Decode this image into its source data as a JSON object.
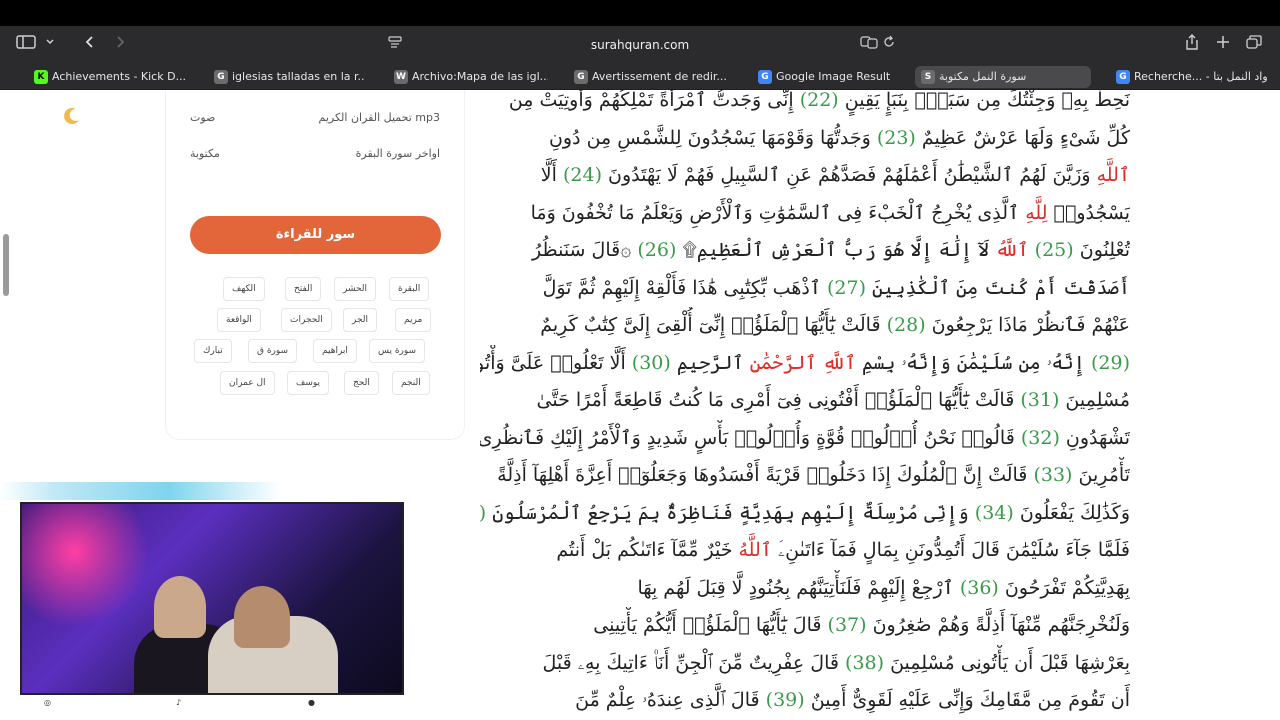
{
  "browser": {
    "url": "surahquran.com",
    "tabs": [
      {
        "label": "Achievements - Kick D...",
        "fav": "K",
        "color": "#53fc18"
      },
      {
        "label": "iglesias talladas en la r...",
        "fav": "G",
        "color": "#6b6b6b"
      },
      {
        "label": "Archivo:Mapa de las igl...",
        "fav": "W",
        "color": "#6b6b6b"
      },
      {
        "label": "Avertissement de redir...",
        "fav": "G",
        "color": "#6b6b6b"
      },
      {
        "label": "Google Image Result",
        "fav": "G",
        "color": "#4285f4"
      },
      {
        "label": "سورة النمل مكتوبة",
        "fav": "S",
        "color": "#6b6b6b"
      },
      {
        "label": "Recherche... - واد النمل بتا",
        "fav": "G",
        "color": "#4285f4"
      }
    ]
  },
  "sidebar": {
    "rows": [
      {
        "left": "صوت",
        "right": "تحميل القران الكريم mp3"
      },
      {
        "left": "مكتوبة",
        "right": "اواخر سورة البقرة"
      }
    ],
    "cta": "سور للقراءة",
    "chips": [
      [
        "البقرة",
        "الحشر",
        "الفتح",
        "الكهف"
      ],
      [
        "مريم",
        "الجر",
        "الحجرات",
        "الواقعة"
      ],
      [
        "سورة يس",
        "ابراهيم",
        "سورة ق",
        "تبارك"
      ],
      [
        "النجم",
        "الحج",
        "يوسف",
        "ال عمران"
      ]
    ]
  },
  "quran": {
    "lines": [
      [
        {
          "t": "نَحِطْ بِهِۦ وَجِئْتُكَ مِن سَبَإٍۭ بِنَبَإٍ يَقِينٍ "
        },
        {
          "t": "(22)",
          "c": "n"
        },
        {
          "t": " إِنِّى وَجَدتُّ ٱمْرَأَةً تَمْلِكُهُمْ وَأُوتِيَتْ مِن"
        }
      ],
      [
        {
          "t": "كُلِّ شَىْءٍ وَلَهَا عَرْشٌ عَظِيمٌ "
        },
        {
          "t": "(23)",
          "c": "n"
        },
        {
          "t": " وَجَدتُّهَا وَقَوْمَهَا يَسْجُدُونَ لِلشَّمْسِ مِن دُونِ"
        }
      ],
      [
        {
          "t": "ٱللَّهِ",
          "c": "a"
        },
        {
          "t": " وَزَيَّنَ لَهُمُ ٱلشَّيْطَٰنُ أَعْمَٰلَهُمْ فَصَدَّهُمْ عَنِ ٱلسَّبِيلِ فَهُمْ لَا يَهْتَدُونَ "
        },
        {
          "t": "(24)",
          "c": "n"
        },
        {
          "t": " أَلَّا"
        }
      ],
      [
        {
          "t": "يَسْجُدُوا۟ "
        },
        {
          "t": "لِلَّهِ",
          "c": "a"
        },
        {
          "t": " ٱلَّذِى يُخْرِجُ ٱلْخَبْءَ فِى ٱلسَّمَٰوَٰتِ وَٱلْأَرْضِ وَيَعْلَمُ مَا تُخْفُونَ وَمَا"
        }
      ],
      [
        {
          "t": "تُعْلِنُونَ "
        },
        {
          "t": "(25)",
          "c": "n"
        },
        {
          "t": " "
        },
        {
          "t": "ٱللَّهُ",
          "c": "a"
        },
        {
          "t": " لَآ إِلَٰهَ إِلَّا هُوَ رَبُّ ٱلْعَرْشِ ٱلْعَظِيمِ۩ "
        },
        {
          "t": "(26)",
          "c": "n"
        },
        {
          "t": " ۞قَالَ سَنَنظُرُ"
        }
      ],
      [
        {
          "t": "أَصَدَقْتَ أَمْ كُنتَ مِنَ ٱلْكَٰذِبِينَ "
        },
        {
          "t": "(27)",
          "c": "n"
        },
        {
          "t": " ٱذْهَب بِّكِتَٰبِى هَٰذَا فَأَلْقِهْ إِلَيْهِمْ ثُمَّ تَوَلَّ"
        }
      ],
      [
        {
          "t": "عَنْهُمْ فَٱنظُرْ مَاذَا يَرْجِعُونَ "
        },
        {
          "t": "(28)",
          "c": "n"
        },
        {
          "t": " قَالَتْ يَٰٓأَيُّهَا ٱلْمَلَؤُا۟ إِنِّىٓ أُلْقِىَ إِلَىَّ كِتَٰبٌ كَرِيمٌ"
        }
      ],
      [
        {
          "t": "(29)",
          "c": "n"
        },
        {
          "t": " إِنَّهُۥ مِن سُلَيْمَٰنَ وَإِنَّهُۥ بِسْمِ "
        },
        {
          "t": "ٱللَّهِ ٱلرَّحْمَٰنِ",
          "c": "a"
        },
        {
          "t": " ٱلرَّحِيمِ "
        },
        {
          "t": "(30)",
          "c": "n"
        },
        {
          "t": " أَلَّا تَعْلُوا۟ عَلَىَّ وَأْتُونِى"
        }
      ],
      [
        {
          "t": "مُسْلِمِينَ "
        },
        {
          "t": "(31)",
          "c": "n"
        },
        {
          "t": " قَالَتْ يَٰٓأَيُّهَا ٱلْمَلَؤُا۟ أَفْتُونِى فِىٓ أَمْرِى مَا كُنتُ قَاطِعَةً أَمْرًا حَتَّىٰ"
        }
      ],
      [
        {
          "t": "تَشْهَدُونِ "
        },
        {
          "t": "(32)",
          "c": "n"
        },
        {
          "t": " قَالُوا۟ نَحْنُ أُو۟لُوا۟ قُوَّةٍ وَأُو۟لُوا۟ بَأْسٍ شَدِيدٍ وَٱلْأَمْرُ إِلَيْكِ فَٱنظُرِى مَاذَا"
        }
      ],
      [
        {
          "t": "تَأْمُرِينَ "
        },
        {
          "t": "(33)",
          "c": "n"
        },
        {
          "t": " قَالَتْ إِنَّ ٱلْمُلُوكَ إِذَا دَخَلُوا۟ قَرْيَةً أَفْسَدُوهَا وَجَعَلُوٓا۟ أَعِزَّةَ أَهْلِهَآ أَذِلَّةً"
        }
      ],
      [
        {
          "t": "وَكَذَٰلِكَ يَفْعَلُونَ "
        },
        {
          "t": "(34)",
          "c": "n"
        },
        {
          "t": " وَإِنِّى مُرْسِلَةٌ إِلَيْهِم بِهَدِيَّةٍ فَنَاظِرَةٌۢ بِمَ يَرْجِعُ ٱلْمُرْسَلُونَ "
        },
        {
          "t": "(35)",
          "c": "n"
        }
      ],
      [
        {
          "t": "فَلَمَّا جَآءَ سُلَيْمَٰنَ قَالَ أَتُمِدُّونَنِ بِمَالٍ فَمَآ ءَاتَىٰنِۦَ "
        },
        {
          "t": "ٱللَّهُ",
          "c": "a"
        },
        {
          "t": " خَيْرٌ مِّمَّآ ءَاتَىٰكُم بَلْ أَنتُم"
        }
      ],
      [
        {
          "t": "بِهَدِيَّتِكُمْ تَفْرَحُونَ "
        },
        {
          "t": "(36)",
          "c": "n"
        },
        {
          "t": " ٱرْجِعْ إِلَيْهِمْ فَلَنَأْتِيَنَّهُم بِجُنُودٍ لَّا قِبَلَ لَهُم بِهَا"
        }
      ],
      [
        {
          "t": "وَلَنُخْرِجَنَّهُم مِّنْهَآ أَذِلَّةً وَهُمْ صَٰغِرُونَ "
        },
        {
          "t": "(37)",
          "c": "n"
        },
        {
          "t": " قَالَ يَٰٓأَيُّهَا ٱلْمَلَؤُا۟ أَيُّكُمْ يَأْتِينِى"
        }
      ],
      [
        {
          "t": "بِعَرْشِهَا قَبْلَ أَن يَأْتُونِى مُسْلِمِينَ "
        },
        {
          "t": "(38)",
          "c": "n"
        },
        {
          "t": " قَالَ عِفْرِيتٌ مِّنَ ٱلْجِنِّ أَنَا۠ ءَاتِيكَ بِهِۦ قَبْلَ"
        }
      ],
      [
        {
          "t": "أَن تَقُومَ مِن مَّقَامِكَ وَإِنِّى عَلَيْهِ لَقَوِىٌّ أَمِينٌ "
        },
        {
          "t": "(39)",
          "c": "n"
        },
        {
          "t": " قَالَ ٱلَّذِى عِندَهُۥ عِلْمٌ مِّنَ"
        }
      ]
    ]
  },
  "colors": {
    "ayah_number": "#3a9a4a",
    "allah_name": "#d9302a",
    "cta": "#e2663a"
  },
  "icons": {
    "sidebar": "sidebar-icon",
    "back": "back-icon",
    "forward": "forward-icon",
    "share": "share-icon",
    "new_tab": "plus-icon",
    "tabs_overview": "tabs-icon",
    "theme": "moon-icon"
  }
}
